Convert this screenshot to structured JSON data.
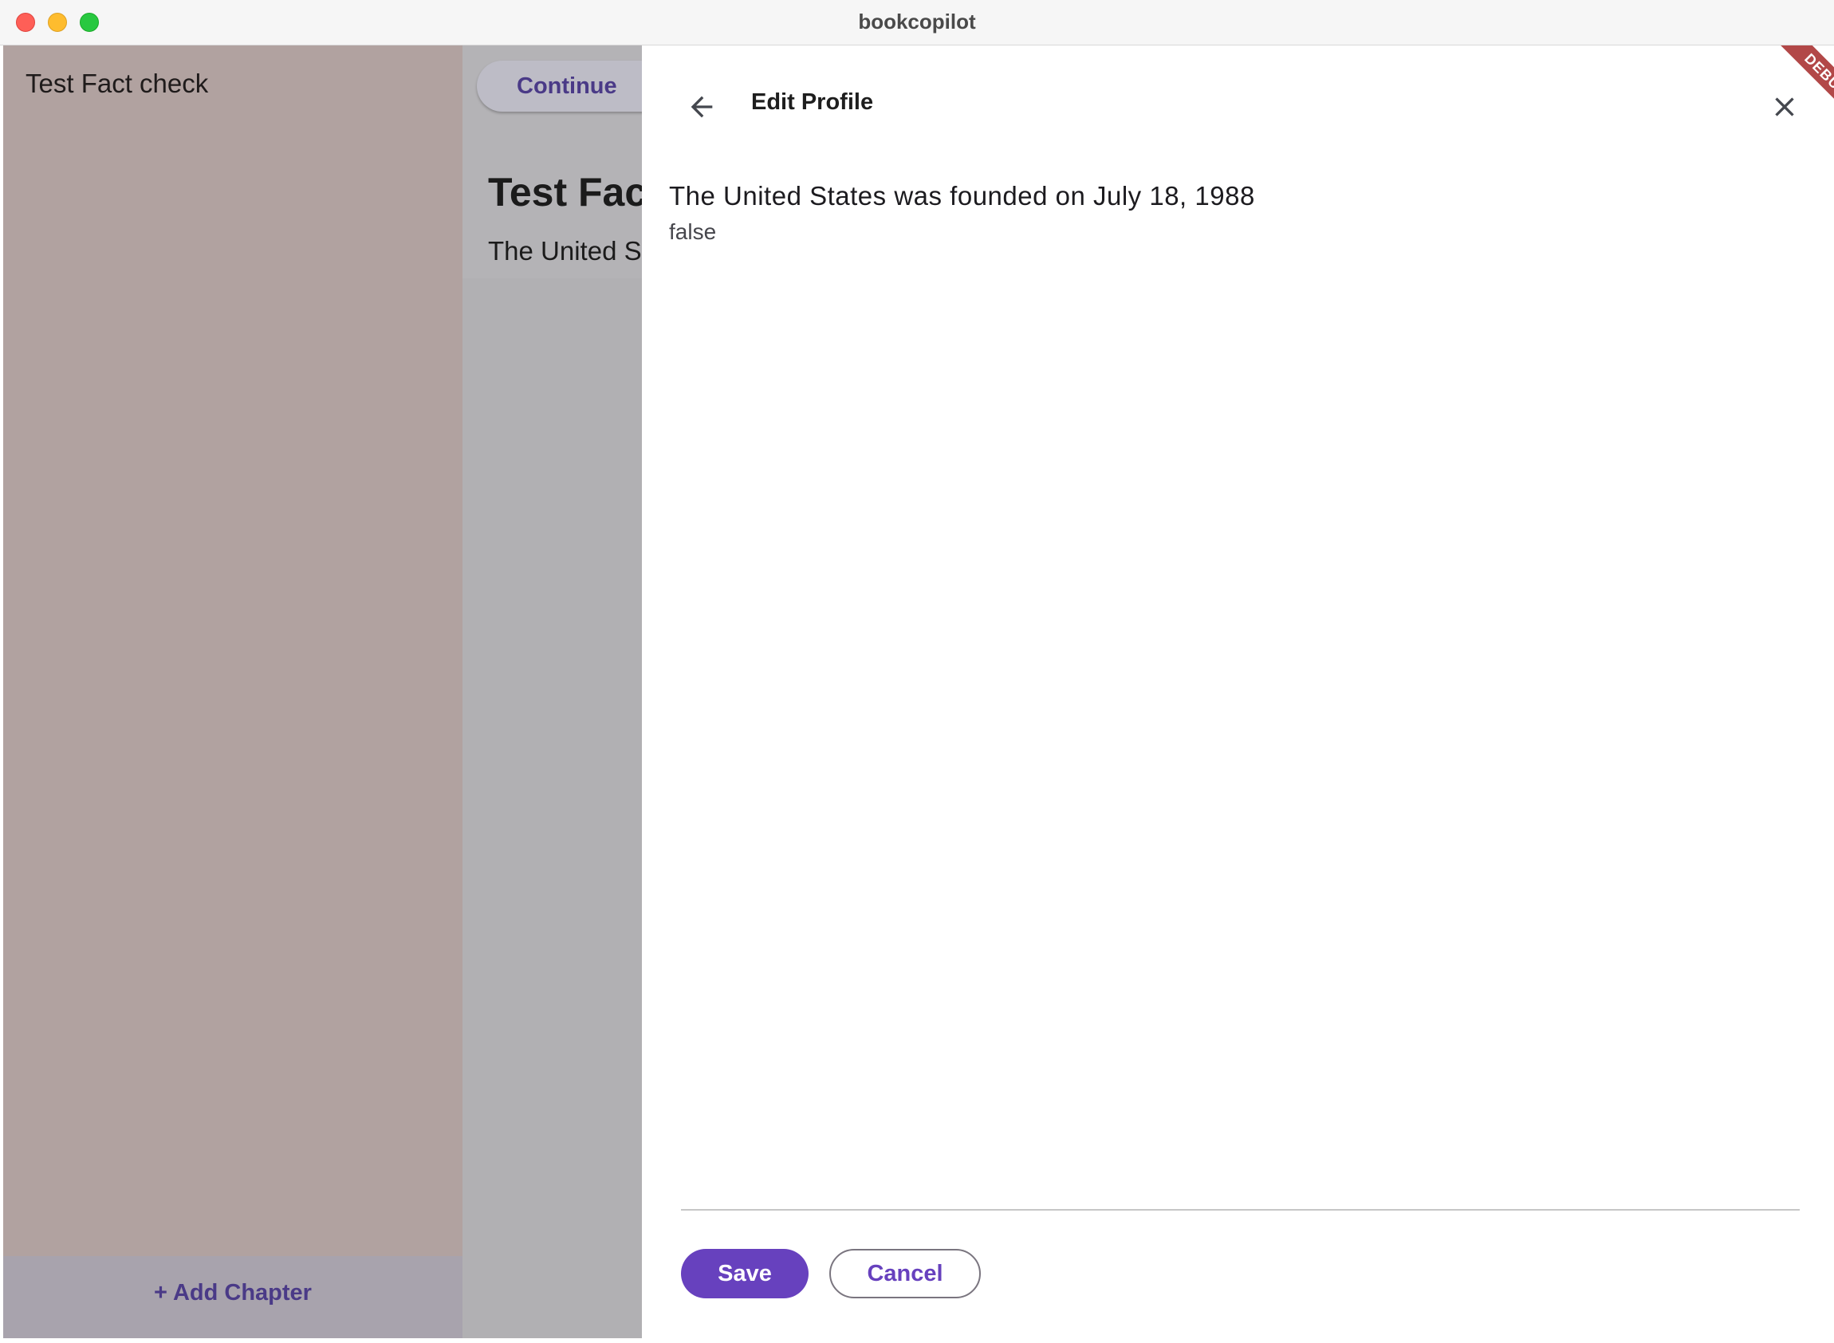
{
  "window": {
    "title": "bookcopilot"
  },
  "sidebar": {
    "book_title": "Test Fact check",
    "add_chapter_label": "+ Add Chapter"
  },
  "main": {
    "continue_label": "Continue",
    "heading": "Test Fac",
    "body_text": "The United S"
  },
  "panel": {
    "title": "Edit Profile",
    "statement": "The United States was founded on July 18, 1988",
    "verdict": "false",
    "save_label": "Save",
    "cancel_label": "Cancel",
    "back_icon": "arrow-back-icon",
    "close_icon": "close-icon"
  },
  "debug_banner": "DEBUG",
  "colors": {
    "accent": "#6741be",
    "label_purple": "#4a3a87",
    "sidebar_bg": "#b1a2a0",
    "debug_red": "#a42828"
  }
}
